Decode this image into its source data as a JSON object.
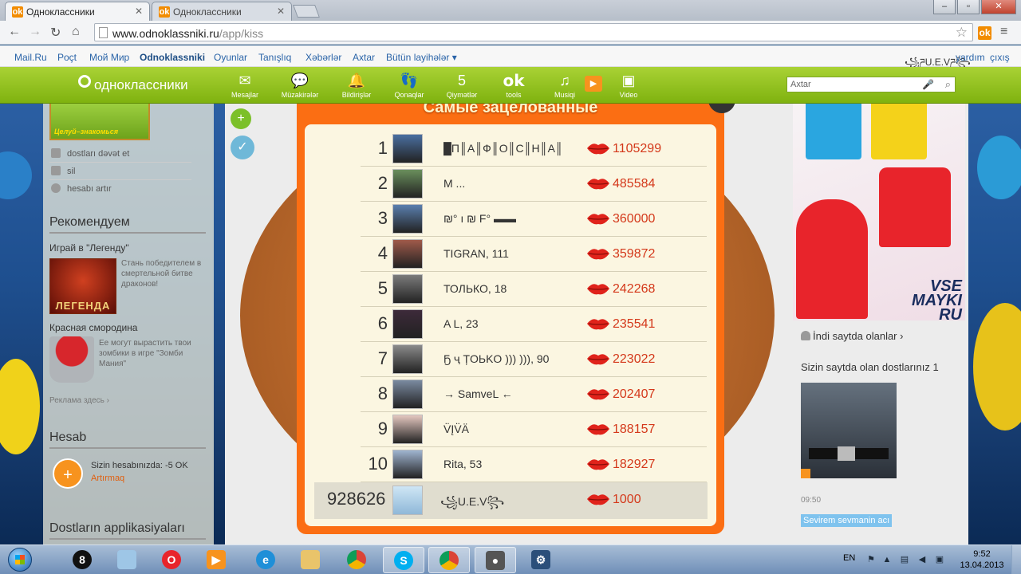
{
  "browser": {
    "tabs": [
      {
        "title": "Одноклассники",
        "active": true
      },
      {
        "title": "Одноклассники",
        "active": false
      }
    ],
    "url_host": "www.odnoklassniki.ru",
    "url_path": "/app/kiss",
    "window_buttons": [
      "–",
      "▫",
      "✕"
    ]
  },
  "portal_links": [
    "Mail.Ru",
    "Poçt",
    "Мой Мир",
    "Odnoklassniki",
    "Oyunlar",
    "Tanışlıq",
    "Xəbərlər",
    "Axtar",
    "Bütün layihələr ▾"
  ],
  "portal_right": {
    "user": "꧁ཌU.E.Vཌ꧂",
    "help": "yardım",
    "logout": "çıxış"
  },
  "site": {
    "logo": "одноклассники",
    "nav": [
      {
        "icon": "✉",
        "icon_name": "mail-icon",
        "label": "Mesajlar"
      },
      {
        "icon": "💬",
        "icon_name": "chat-icon",
        "label": "Müzakirələr"
      },
      {
        "icon": "🔔",
        "icon_name": "bell-icon",
        "label": "Bildirişlər"
      },
      {
        "icon": "👣",
        "icon_name": "footprints-icon",
        "label": "Qonaqlar"
      },
      {
        "icon": "5",
        "icon_name": "rating-icon",
        "label": "Qiymətlər"
      },
      {
        "icon": "ok",
        "icon_name": "ok-tools-icon",
        "label": "tools"
      },
      {
        "icon": "♫",
        "icon_name": "music-icon",
        "label": "Musiqi"
      },
      {
        "icon": "▣",
        "icon_name": "video-icon",
        "label": "Video"
      }
    ],
    "search_placeholder": "Axtar"
  },
  "left": {
    "banner": "Целуй–знакомься",
    "menu": [
      "dostları dəvət et",
      "sil",
      "hesabı artır"
    ],
    "recommend_title": "Рекомендуем",
    "promo1_title": "Играй в \"Легенду\"",
    "promo1_desc": "Стань победителем в смертельной битве драконов!",
    "promo1_img_text": "ЛЕГЕНДА",
    "promo2_title": "Красная смородина",
    "promo2_desc": "Ее могут вырастить твои зомбики в игре \"Зомби Мания\"",
    "ads_link": "Реклама здесь ›",
    "account_title": "Hesab",
    "balance": "Sizin hesabınızda: -5 OK",
    "topup": "Artırmaq",
    "apps_title": "Dostların applikasiyaları"
  },
  "game": {
    "title": "Самые зацелованные",
    "ranking": [
      {
        "rank": "1",
        "name": "█П║А║Ф║О║С║Н║А║",
        "kisses": "1105299"
      },
      {
        "rank": "2",
        "name": "M ...",
        "kisses": "485584"
      },
      {
        "rank": "3",
        "name": "₪° ı ₪ F° ▬▬",
        "kisses": "360000"
      },
      {
        "rank": "4",
        "name": "TIGRAN, 111",
        "kisses": "359872"
      },
      {
        "rank": "5",
        "name": "ТОЛЬКО, 18",
        "kisses": "242268"
      },
      {
        "rank": "6",
        "name": "A L, 23",
        "kisses": "235541"
      },
      {
        "rank": "7",
        "name": "Ҕ ҷ ȚOЬKO ))) ))), 90",
        "kisses": "223022"
      },
      {
        "rank": "8",
        "name": "→ SamveL ←",
        "kisses": "202407"
      },
      {
        "rank": "9",
        "name": "V̈ĮV̈Ä",
        "kisses": "188157"
      },
      {
        "rank": "10",
        "name": "Rita, 53",
        "kisses": "182927"
      }
    ],
    "my_rank": {
      "rank": "928626",
      "name": "꧁U.E.V꧂",
      "kisses": "1000"
    }
  },
  "right": {
    "ad_text": [
      "VSE",
      "MAYKI",
      "RU"
    ],
    "online_link": "İndi saytda olanlar ›",
    "friends_online": "Sizin saytda olan dostlarınız 1",
    "time": "09:50",
    "status": "Sevirem sevmanin acı"
  },
  "taskbar": {
    "lang": "EN",
    "time": "9:52",
    "date": "13.04.2013"
  },
  "colors": {
    "green_bar": "#8ec21f",
    "orange_panel": "#fb6e13",
    "kiss_red": "#d4381a"
  }
}
